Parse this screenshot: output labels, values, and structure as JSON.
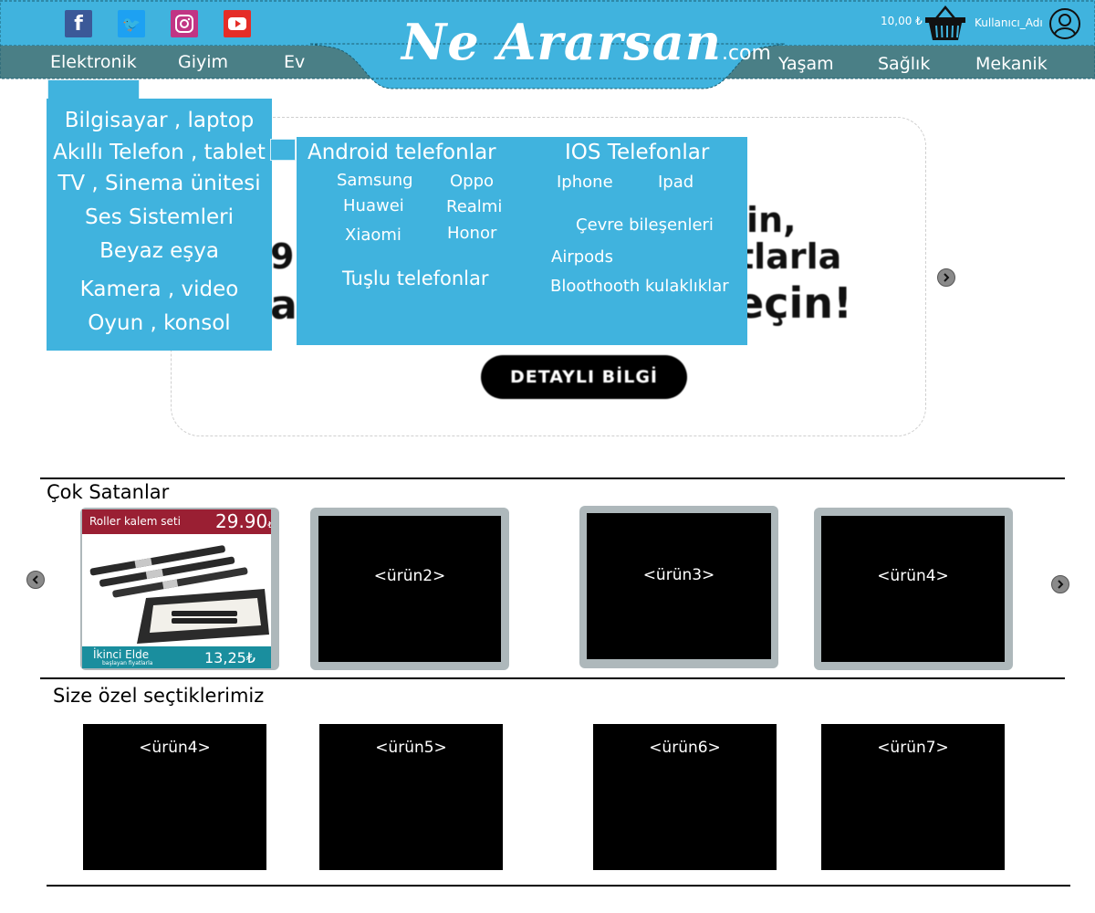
{
  "header": {
    "social": [
      {
        "name": "facebook-icon",
        "glyph": "f",
        "color": "#3b5998"
      },
      {
        "name": "twitter-icon",
        "glyph": "🐦",
        "color": "#1da1f2"
      },
      {
        "name": "instagram-icon",
        "glyph": "◎",
        "color": "#c13584"
      },
      {
        "name": "youtube-icon",
        "glyph": "▶",
        "color": "#e52d27"
      }
    ],
    "logo_main": "Ne Ararsan",
    "logo_domain": ".com",
    "cart_price": "10,00 ₺",
    "user_name": "Kullanıcı_Adı",
    "nav_left": [
      "Elektronik",
      "Giyim",
      "Ev"
    ],
    "nav_right": [
      "Yaşam",
      "Sağlık",
      "Mekanik"
    ]
  },
  "menu_left": [
    "Bilgisayar , laptop",
    "Akıllı Telefon , tablet",
    "TV , Sinema ünitesi",
    "Ses Sistemleri",
    "Beyaz eşya",
    "Kamera , video",
    "Oyun , konsol"
  ],
  "menu_right": {
    "android_title": "Android telefonlar",
    "android_brands": [
      "Samsung",
      "Oppo",
      "Huawei",
      "Realmi",
      "Xiaomi",
      "Honor"
    ],
    "tuslu": "Tuşlu telefonlar",
    "ios_title": "IOS Telefonlar",
    "ios_items": [
      "Iphone",
      "Ipad"
    ],
    "cevre": "Çevre bileşenleri",
    "airpods": "Airpods",
    "bluetooth": "Bloothooth kulaklıklar"
  },
  "banner": {
    "line1": "in,",
    "line2": "tlarla",
    "line2_left": "9",
    "line3": "eçin!",
    "line3_left": "al",
    "button": "DETAYLI BİLGİ"
  },
  "best_sellers": {
    "title": "Çok Satanlar",
    "featured": {
      "name": "Roller kalem seti",
      "price": "29.90",
      "currency": "₺",
      "second_label": "İkinci Elde",
      "second_sub": "başlayan fiyatlarla",
      "second_price": "13,25₺"
    },
    "products": [
      "<ürün2>",
      "<ürün3>",
      "<ürün4>"
    ]
  },
  "picks": {
    "title": "Size özel seçtiklerimiz",
    "products": [
      "<ürün4>",
      "<ürün5>",
      "<ürün6>",
      "<ürün7>"
    ]
  },
  "colors": {
    "header_blue": "#40b3de",
    "header_dark": "#4a7f86",
    "menu_blue": "#40b3de",
    "card_frame": "#aeb8bb",
    "featured_red": "#9a1f33",
    "featured_teal": "#1a8e9e"
  }
}
